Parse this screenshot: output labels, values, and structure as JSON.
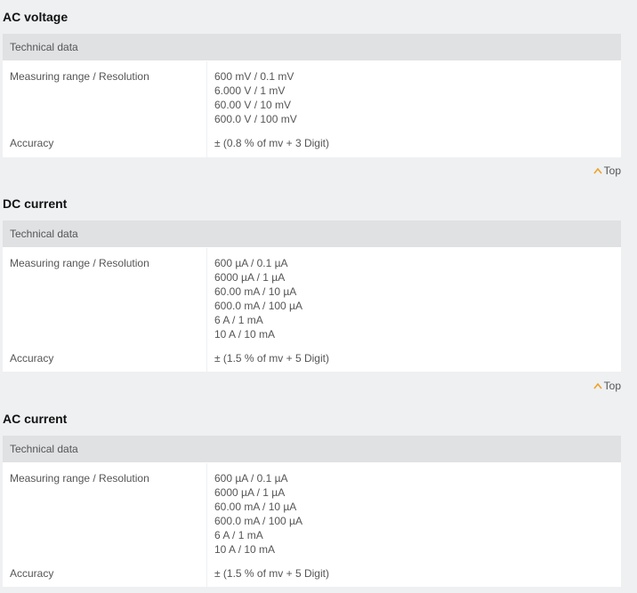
{
  "sections": [
    {
      "title": "AC voltage",
      "header": "Technical data",
      "rows": [
        {
          "label": "Measuring range / Resolution",
          "values": [
            "600 mV / 0.1 mV",
            "6.000 V / 1 mV",
            "60.00 V / 10 mV",
            "600.0 V / 100 mV"
          ]
        },
        {
          "label": "Accuracy",
          "values": [
            "± (0.8 % of mv + 3 Digit)"
          ]
        }
      ],
      "top_link": "Top"
    },
    {
      "title": "DC current",
      "header": "Technical data",
      "rows": [
        {
          "label": "Measuring range / Resolution",
          "values": [
            "600 µA / 0.1 µA",
            "6000 µA / 1 µA",
            "60.00 mA / 10 µA",
            "600.0 mA / 100 µA",
            "6 A / 1 mA",
            "10 A / 10 mA"
          ]
        },
        {
          "label": "Accuracy",
          "values": [
            "± (1.5 % of mv + 5 Digit)"
          ]
        }
      ],
      "top_link": "Top"
    },
    {
      "title": "AC current",
      "header": "Technical data",
      "rows": [
        {
          "label": "Measuring range / Resolution",
          "values": [
            "600 µA / 0.1 µA",
            "6000 µA / 1 µA",
            "60.00 mA / 10 µA",
            "600.0 mA / 100 µA",
            "6 A / 1 mA",
            "10 A / 10 mA"
          ]
        },
        {
          "label": "Accuracy",
          "values": [
            "± (1.5 % of mv + 5 Digit)"
          ]
        }
      ]
    }
  ],
  "colors": {
    "page_background": "#eef0f2",
    "header_background": "#dfe1e3",
    "table_background": "#ffffff",
    "text": "#555555",
    "title": "#111111",
    "caret_accent": "#f0a020"
  },
  "icons": {
    "top_link_icon": "caret-up-icon"
  }
}
